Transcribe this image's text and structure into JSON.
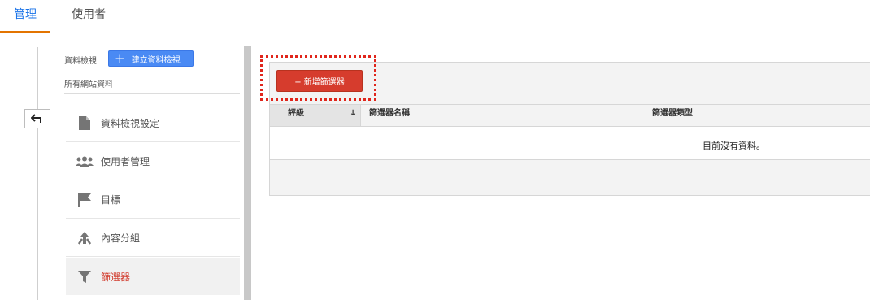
{
  "tabs": [
    {
      "label": "管理",
      "active": true
    },
    {
      "label": "使用者",
      "active": false
    }
  ],
  "view": {
    "label": "資料檢視",
    "create_button": "建立資料檢視",
    "selected": "所有網站資料"
  },
  "nav": {
    "items": [
      {
        "label": "資料檢視設定",
        "icon": "document-icon"
      },
      {
        "label": "使用者管理",
        "icon": "people-icon"
      },
      {
        "label": "目標",
        "icon": "flag-icon"
      },
      {
        "label": "內容分組",
        "icon": "content-group-icon"
      },
      {
        "label": "篩選器",
        "icon": "filter-icon",
        "active": true
      }
    ]
  },
  "filters": {
    "add_button": "+ 新增篩選器",
    "columns": [
      "評級",
      "篩選器名稱",
      "篩選器類型"
    ],
    "empty_message": "目前沒有資料。"
  },
  "colors": {
    "accent_blue": "#4a8af4",
    "accent_red": "#d63c2d",
    "active_tab_underline": "#e37400"
  }
}
